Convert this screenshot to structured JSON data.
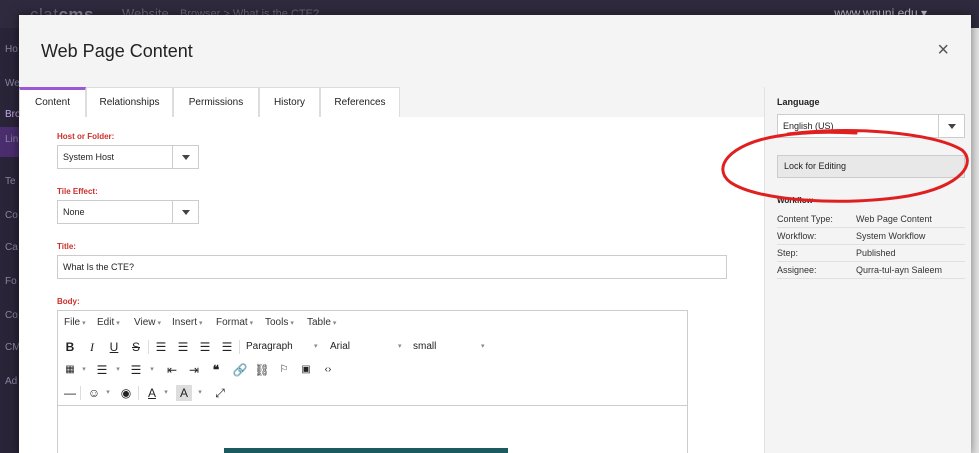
{
  "background": {
    "logo_prefix": "clat",
    "logo_main": "cms",
    "section": "Website",
    "breadcrumb": "Browser  >  What is the CTE?",
    "domain": "www.wpuni.edu ▾",
    "nav": [
      "Ho",
      "We",
      "Bro",
      "Lin",
      "Te",
      "Co",
      "Ca",
      "Fo",
      "Co",
      "CM",
      "Ad"
    ]
  },
  "modal": {
    "title": "Web Page Content",
    "close_glyph": "×"
  },
  "tabs": [
    {
      "label": "Content",
      "active": true
    },
    {
      "label": "Relationships"
    },
    {
      "label": "Permissions"
    },
    {
      "label": "History"
    },
    {
      "label": "References"
    }
  ],
  "form": {
    "host_label": "Host or Folder:",
    "host_value": "System Host",
    "tile_label": "Tile Effect:",
    "tile_value": "None",
    "title_label": "Title:",
    "title_value": "What Is the CTE?",
    "body_label": "Body:"
  },
  "editor": {
    "menus": [
      "File",
      "Edit",
      "View",
      "Insert",
      "Format",
      "Tools",
      "Table"
    ],
    "block_format": "Paragraph",
    "font_family": "Arial",
    "font_size": "small"
  },
  "panel": {
    "language_label": "Language",
    "language_value": "English (US)",
    "lock_label": "Lock for Editing",
    "workflow_label": "Workflow",
    "workflow": [
      {
        "key": "Content Type:",
        "value": "Web Page Content"
      },
      {
        "key": "Workflow:",
        "value": "System Workflow"
      },
      {
        "key": "Step:",
        "value": "Published"
      },
      {
        "key": "Assignee:",
        "value": "Qurra-tul-ayn Saleem"
      }
    ]
  },
  "colors": {
    "accent": "#9b59d8",
    "required_label": "#c9302c",
    "annotation": "#e02020"
  }
}
